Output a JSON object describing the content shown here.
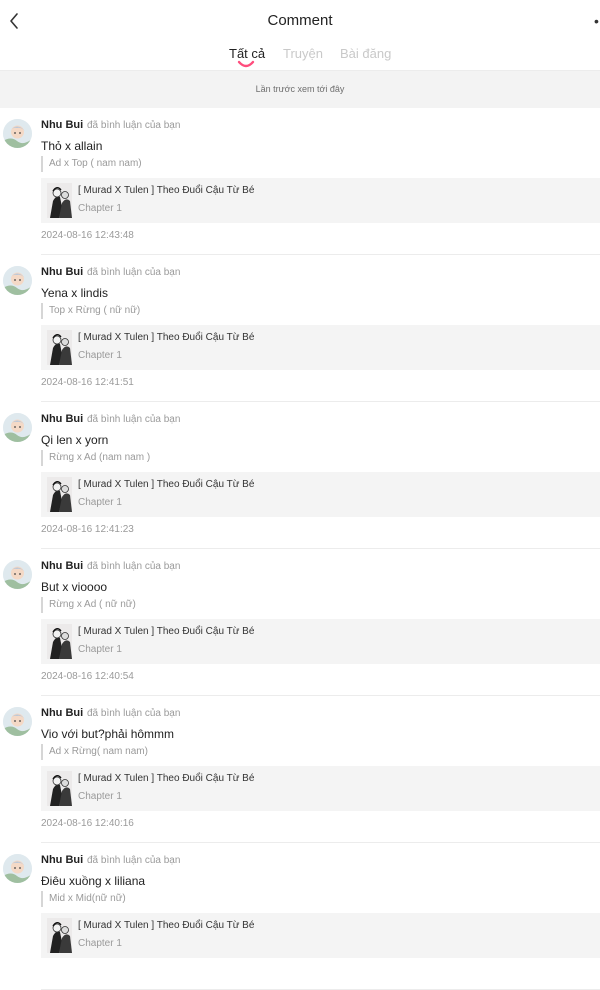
{
  "header": {
    "title": "Comment",
    "back_icon": "chevron-left-icon",
    "more_icon": "more-icon"
  },
  "tabs": [
    {
      "label": "Tất cả",
      "active": true
    },
    {
      "label": "Truyện",
      "active": false
    },
    {
      "label": "Bài đăng",
      "active": false
    }
  ],
  "colors": {
    "accent": "#ff4d7d",
    "inactive_tab": "#c9c9c9",
    "muted": "#9a9a9a"
  },
  "banner": {
    "last_seen": "Lần trước xem tới đây"
  },
  "comments": [
    {
      "user": "Nhu Bui",
      "action": "đã bình luận của bạn",
      "text": "Thỏ x allain",
      "quote": "Ad x Top ( nam nam)",
      "story_title": "[ Murad X Tulen ] Theo Đuổi Cậu Từ Bé",
      "chapter": "Chapter 1",
      "timestamp": "2024-08-16 12:43:48"
    },
    {
      "user": "Nhu Bui",
      "action": "đã bình luận của bạn",
      "text": "Yena x lindis",
      "quote": "Top x Rừng ( nữ nữ)",
      "story_title": "[ Murad X Tulen ] Theo Đuổi Cậu Từ Bé",
      "chapter": "Chapter 1",
      "timestamp": "2024-08-16 12:41:51"
    },
    {
      "user": "Nhu Bui",
      "action": "đã bình luận của bạn",
      "text": "Qi len x yorn",
      "quote": "Rừng x Ad (nam nam )",
      "story_title": "[ Murad X Tulen ] Theo Đuổi Cậu Từ Bé",
      "chapter": "Chapter 1",
      "timestamp": "2024-08-16 12:41:23"
    },
    {
      "user": "Nhu Bui",
      "action": "đã bình luận của bạn",
      "text": "But x vioooo",
      "quote": "Rừng x Ad ( nữ nữ)",
      "story_title": "[ Murad X Tulen ] Theo Đuổi Cậu Từ Bé",
      "chapter": "Chapter 1",
      "timestamp": "2024-08-16 12:40:54"
    },
    {
      "user": "Nhu Bui",
      "action": "đã bình luận của bạn",
      "text": "Vio với but?phải hômmm",
      "quote": "Ad x Rừng( nam nam)",
      "story_title": "[ Murad X Tulen ] Theo Đuổi Cậu Từ Bé",
      "chapter": "Chapter 1",
      "timestamp": "2024-08-16 12:40:16"
    },
    {
      "user": "Nhu Bui",
      "action": "đã bình luận của bạn",
      "text": "Điêu xuồng x liliana",
      "quote": "Mid x Mid(nữ nữ)",
      "story_title": "[ Murad X Tulen ] Theo Đuổi Cậu Từ Bé",
      "chapter": "Chapter 1",
      "timestamp": ""
    }
  ]
}
